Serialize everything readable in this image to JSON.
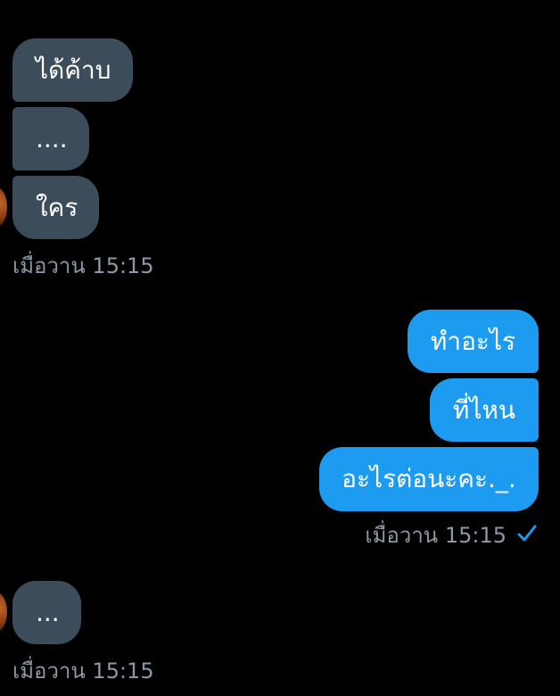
{
  "received_group_1": {
    "messages": [
      "ได้ค้าบ",
      "....",
      "ใคร"
    ],
    "timestamp": "เมื่อวาน 15:15"
  },
  "sent_group": {
    "messages": [
      "ทำอะไร",
      "ที่ไหน",
      "อะไรต่อนะคะ._."
    ],
    "timestamp": "เมื่อวาน 15:15",
    "status_icon": "check-icon"
  },
  "received_group_2": {
    "messages": [
      "..."
    ],
    "timestamp": "เมื่อวาน 15:15"
  },
  "colors": {
    "background": "#000000",
    "received_bubble": "#3d4c5a",
    "sent_bubble": "#1d9bf0",
    "timestamp_text": "#8b98a5",
    "check": "#1d9bf0"
  }
}
